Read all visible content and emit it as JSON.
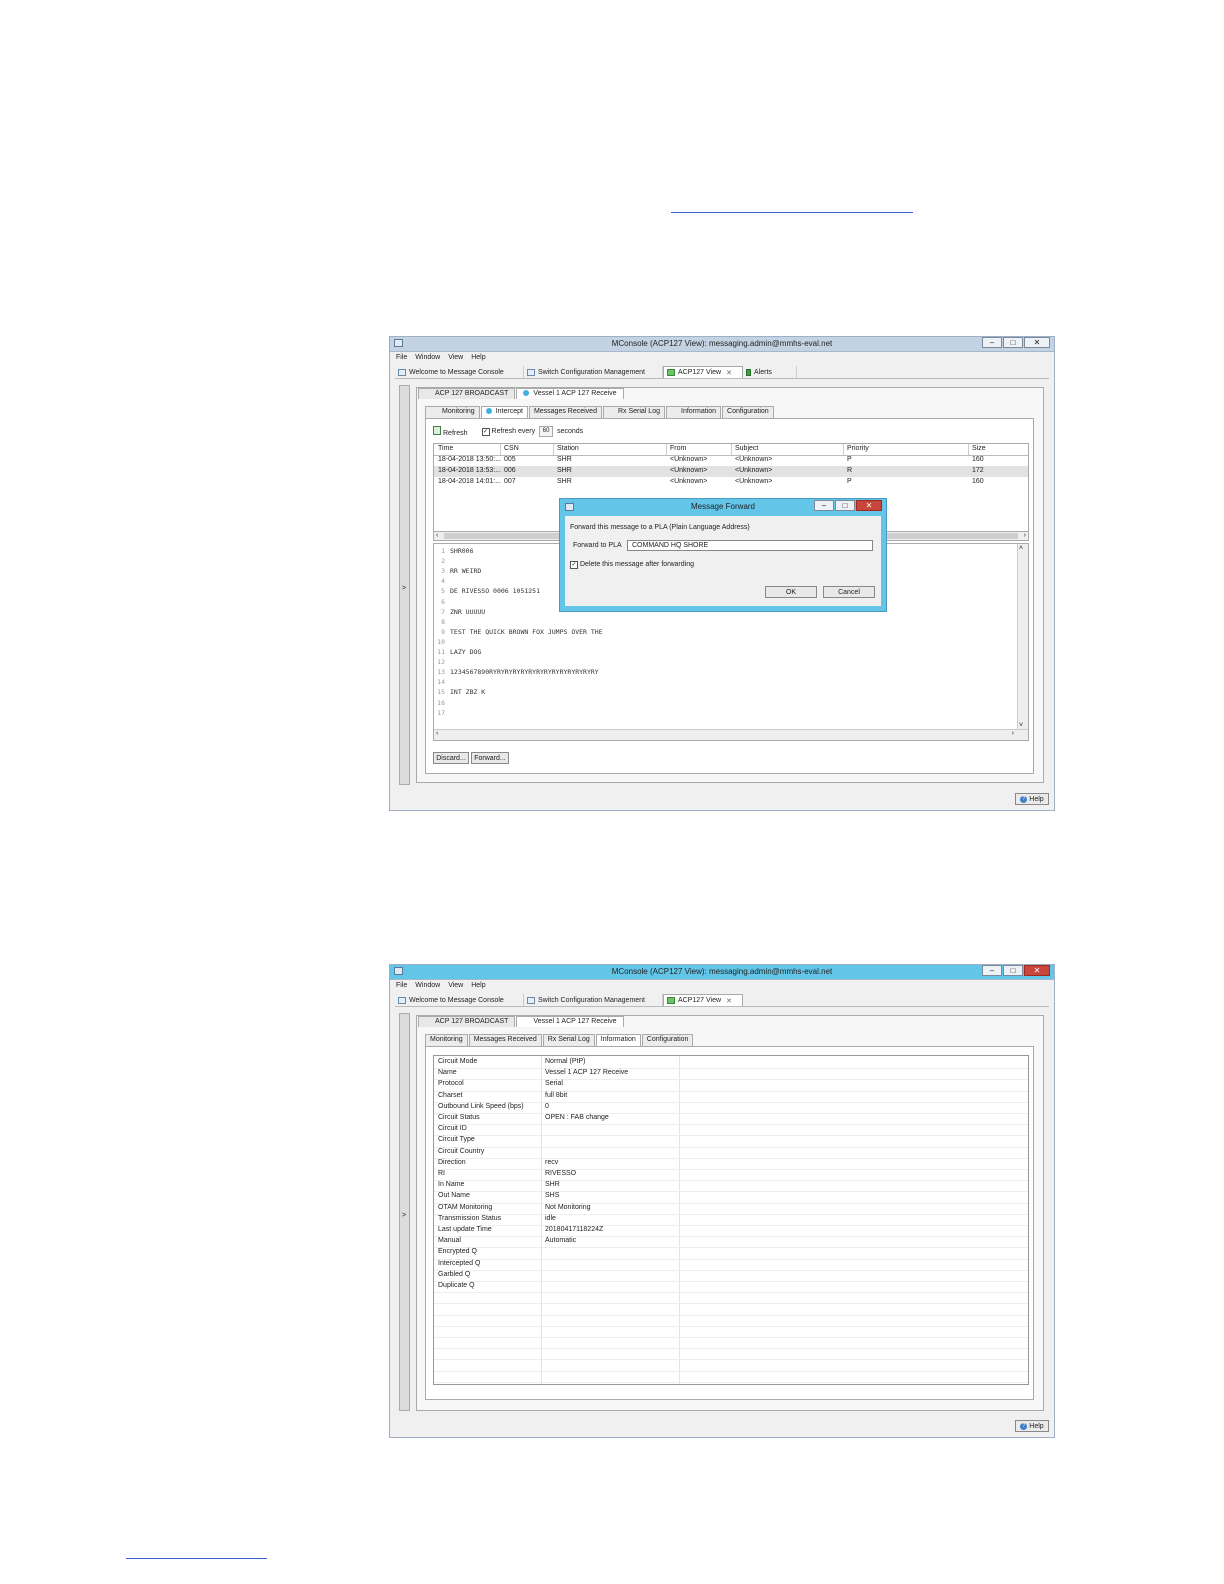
{
  "window1": {
    "title": "MConsole (ACP127 View): messaging.admin@mmhs-eval.net",
    "menu": [
      "File",
      "Window",
      "View",
      "Help"
    ],
    "view_tabs": [
      "Welcome to Message Console",
      "Switch Configuration Management",
      "ACP127 View",
      "Alerts"
    ],
    "circuit_tabs": [
      "ACP 127 BROADCAST",
      "Vessel 1 ACP 127 Receive"
    ],
    "sub_tabs": [
      "Monitoring",
      "Intercept",
      "Messages Received",
      "Rx Serial Log",
      "Information",
      "Configuration"
    ],
    "toolbar": {
      "refresh": "Refresh",
      "refresh_every": "Refresh every",
      "seconds_value": "60",
      "seconds": "seconds"
    },
    "table": {
      "headers": [
        "Time",
        "CSN",
        "Station",
        "From",
        "Subject",
        "Priority",
        "Size"
      ],
      "rows": [
        [
          "18-04-2018 13:50:...",
          "005",
          "SHR",
          "<Unknown>",
          "<Unknown>",
          "P",
          "160"
        ],
        [
          "18-04-2018 13:53:...",
          "006",
          "SHR",
          "<Unknown>",
          "<Unknown>",
          "R",
          "172"
        ],
        [
          "18-04-2018 14:01:...",
          "007",
          "SHR",
          "<Unknown>",
          "<Unknown>",
          "P",
          "160"
        ]
      ]
    },
    "message_lines": [
      [
        "1",
        "SHR006"
      ],
      [
        "2",
        ""
      ],
      [
        "3",
        "RR WEIRD"
      ],
      [
        "4",
        ""
      ],
      [
        "5",
        "DE RIVESSO 0006 1051251"
      ],
      [
        "6",
        ""
      ],
      [
        "7",
        "ZNR UUUUU"
      ],
      [
        "8",
        ""
      ],
      [
        "9",
        "TEST THE QUICK BROWN FOX JUMPS OVER THE"
      ],
      [
        "10",
        ""
      ],
      [
        "11",
        "LAZY DOG"
      ],
      [
        "12",
        ""
      ],
      [
        "13",
        "1234567890RYRYRYRYRYRYRYRYRYRYRYRYRYRY"
      ],
      [
        "14",
        ""
      ],
      [
        "15",
        "INT ZBZ K"
      ],
      [
        "16",
        ""
      ],
      [
        "17",
        ""
      ]
    ],
    "buttons": {
      "discard": "Discard...",
      "forward": "Forward..."
    },
    "help": "Help",
    "side_toggle": ">",
    "dialog": {
      "title": "Message Forward",
      "prompt": "Forward this message to a PLA (Plain Language Address)",
      "field_label": "Forward to PLA",
      "field_value": "COMMAND HQ SHORE",
      "checkbox_label": "Delete this message after forwarding",
      "ok": "OK",
      "cancel": "Cancel"
    }
  },
  "window2": {
    "title": "MConsole (ACP127 View): messaging.admin@mmhs-eval.net",
    "menu": [
      "File",
      "Window",
      "View",
      "Help"
    ],
    "view_tabs": [
      "Welcome to Message Console",
      "Switch Configuration Management",
      "ACP127 View"
    ],
    "circuit_tabs": [
      "ACP 127 BROADCAST",
      "Vessel 1 ACP 127 Receive"
    ],
    "sub_tabs": [
      "Monitoring",
      "Messages Received",
      "Rx Serial Log",
      "Information",
      "Configuration"
    ],
    "info_rows": [
      [
        "Circuit Mode",
        "Normal (PtP)"
      ],
      [
        "Name",
        "Vessel 1 ACP 127 Receive"
      ],
      [
        "Protocol",
        "Serial"
      ],
      [
        "Charset",
        "full 8bit"
      ],
      [
        "Outbound Link Speed (bps)",
        "0"
      ],
      [
        "Circuit Status",
        "OPEN : FAB change"
      ],
      [
        "Circuit ID",
        ""
      ],
      [
        "Circuit Type",
        ""
      ],
      [
        "Circuit Country",
        ""
      ],
      [
        "Direction",
        "recv"
      ],
      [
        "RI",
        "RIVESSO"
      ],
      [
        "In Name",
        "SHR"
      ],
      [
        "Out Name",
        "SHS"
      ],
      [
        "OTAM Monitoring",
        "Not Monitoring"
      ],
      [
        "Transmission Status",
        "idle"
      ],
      [
        "Last update Time",
        "20180417118224Z"
      ],
      [
        "Manual",
        "Automatic"
      ],
      [
        "Encrypted Q",
        ""
      ],
      [
        "Intercepted Q",
        ""
      ],
      [
        "Garbled Q",
        ""
      ],
      [
        "Duplicate Q",
        ""
      ]
    ],
    "help": "Help",
    "side_toggle": ">"
  }
}
